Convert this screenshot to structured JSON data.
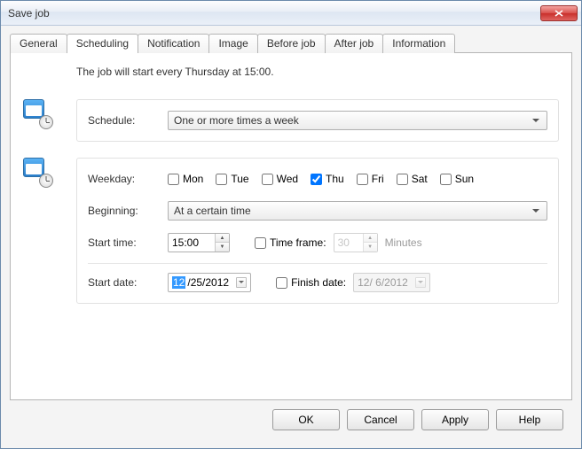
{
  "window": {
    "title": "Save job"
  },
  "tabs": {
    "general": "General",
    "scheduling": "Scheduling",
    "notification": "Notification",
    "image": "Image",
    "before": "Before job",
    "after": "After job",
    "information": "Information",
    "active": "scheduling"
  },
  "summary": "The job will start every Thursday at 15:00.",
  "schedule": {
    "label": "Schedule:",
    "value": "One or more times a week"
  },
  "weekday": {
    "label": "Weekday:",
    "days": {
      "mon": {
        "label": "Mon",
        "checked": false
      },
      "tue": {
        "label": "Tue",
        "checked": false
      },
      "wed": {
        "label": "Wed",
        "checked": false
      },
      "thu": {
        "label": "Thu",
        "checked": true
      },
      "fri": {
        "label": "Fri",
        "checked": false
      },
      "sat": {
        "label": "Sat",
        "checked": false
      },
      "sun": {
        "label": "Sun",
        "checked": false
      }
    }
  },
  "beginning": {
    "label": "Beginning:",
    "value": "At a certain time"
  },
  "start_time": {
    "label": "Start time:",
    "value": "15:00"
  },
  "time_frame": {
    "label": "Time frame:",
    "checked": false,
    "minutes": "30",
    "unit": "Minutes"
  },
  "start_date": {
    "label": "Start date:",
    "month_sel": "12",
    "rest": "/25/2012"
  },
  "finish_date": {
    "label": "Finish date:",
    "checked": false,
    "value": "12/ 6/2012"
  },
  "buttons": {
    "ok": "OK",
    "cancel": "Cancel",
    "apply": "Apply",
    "help": "Help"
  }
}
